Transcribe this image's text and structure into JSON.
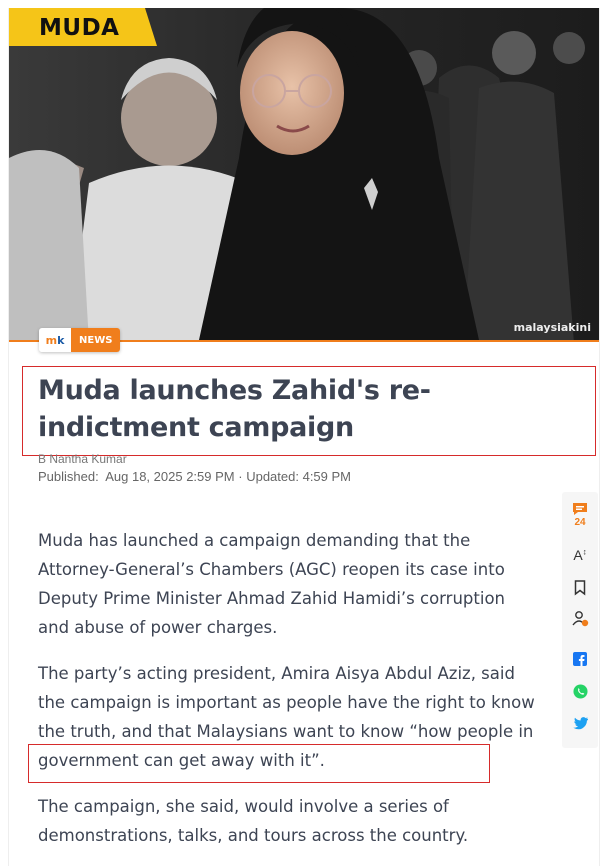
{
  "hero": {
    "tag": "MUDA",
    "watermark": "malaysiakini"
  },
  "badge": {
    "logo_m": "m",
    "logo_k": "k",
    "label": "NEWS"
  },
  "article": {
    "title": "Muda launches Zahid's re-indictment campaign",
    "author": "B Nantha Kumar",
    "published_label": "Published:",
    "published": "Aug 18, 2025 2:59 PM",
    "separator": "·",
    "updated_label": "Updated:",
    "updated": "4:59 PM",
    "paragraphs": [
      "Muda has launched a campaign demanding that the Attorney-General’s Chambers (AGC) reopen its case into Deputy Prime Minister Ahmad Zahid Hamidi’s corruption and abuse of power charges.",
      "The party’s acting president, Amira Aisya Abdul Aziz, said the campaign is important as people have the right to know the truth, and that Malaysians want to know “how people in government can get away with it”.",
      "The campaign, she said, would involve a series of demonstrations, talks, and tours across the country."
    ]
  },
  "tools": {
    "comment_count": "24",
    "font_size_label": "A"
  },
  "colors": {
    "accent": "#f07e1c",
    "highlight": "#d62b2b",
    "tag_yellow": "#f5c518"
  }
}
